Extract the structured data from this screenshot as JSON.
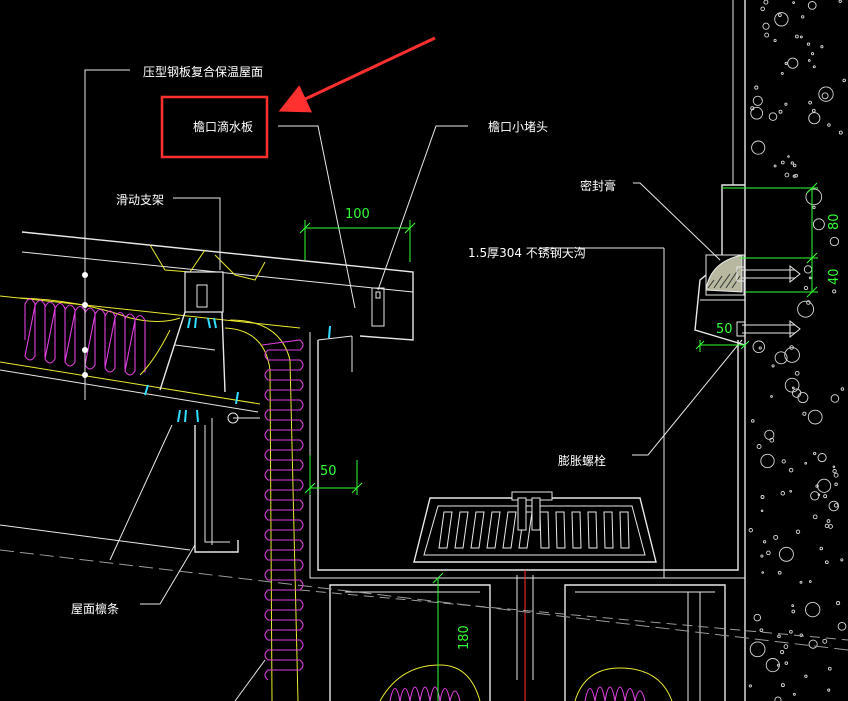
{
  "labels": {
    "roof_panel": "压型钢板复合保温屋面",
    "drip_plate": "檐口滴水板",
    "eave_cap": "檐口小堵头",
    "sliding_bracket": "滑动支架",
    "gutter": "1.5厚304 不锈钢天沟",
    "sealant": "密封膏",
    "expansion_bolt": "膨胀螺栓",
    "purlin": "屋面檩条"
  },
  "dimensions": {
    "d100": "100",
    "d50_left": "50",
    "d50_right": "50",
    "d80": "80",
    "d40": "40",
    "d180": "180"
  },
  "colors": {
    "background": "#000000",
    "linework": "#e8e8e8",
    "dimension": "#33ff33",
    "insulation": "#e040e0",
    "highlight": "#ff3030",
    "fastener": "#33ddff",
    "outline_yellow": "#e8e830"
  },
  "icons": {
    "annotation_arrow": "red-arrow-icon",
    "highlight_box": "red-box"
  }
}
